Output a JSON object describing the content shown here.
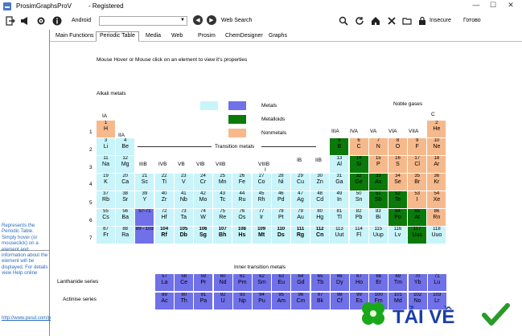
{
  "window": {
    "title": "ProsimGraphsProV",
    "status": "- Registered",
    "controls": [
      "—",
      "☐",
      "✕"
    ]
  },
  "toolbar": {
    "android_label": "Android",
    "dropdown_value": "",
    "websearch_label": "Web Search",
    "insecure_label": "Insecure",
    "ready_label": "Готово"
  },
  "tabs": [
    "Main Functions",
    "Periodic Table",
    "Media",
    "Web",
    "Prosim",
    "ChemDesigner",
    "Graphs"
  ],
  "active_tab": "Periodic Table",
  "help": {
    "text": "Represents the Periodic Table. Simply hover (or mouseclick) on a element and information about the element will be displayed. For details view Help online",
    "link": "http://www.pesd.com/pertable.aspx"
  },
  "periodic": {
    "instruction": "Mouse Hover or Mouse click on an element to view it's properties",
    "alkali_label": "Alkali metals",
    "noble_label": "Noble gases",
    "transition_label": "Transition metals",
    "inner_label": "Inner transition metals",
    "lanthanide_label": "Lanthanide series",
    "actinide_label": "Actinise series",
    "legend": [
      {
        "label": "Metals",
        "color": "#c8f4fa"
      },
      {
        "label": "Metalloids",
        "color": "#0b7a0b"
      },
      {
        "label": "Nonmetals",
        "color": "#f6b98c"
      },
      {
        "label": "",
        "color": "#7070e8"
      }
    ],
    "group_headers": [
      "IA",
      "IIA",
      "IIIB",
      "IVB",
      "VB",
      "VIB",
      "VIIB",
      "VIIIB",
      "I",
      "IB",
      "IIB",
      "IIIA",
      "IVA",
      "VA",
      "VIA",
      "VIIA",
      "C"
    ],
    "period_numbers": [
      "1",
      "2",
      "3",
      "4",
      "5",
      "6",
      "7"
    ]
  },
  "logo": {
    "text": "TẢI VỀ",
    "clover_color": "#1aa81a",
    "text_color": "#1a3fa8",
    "check_color": "#2a9a2a"
  }
}
